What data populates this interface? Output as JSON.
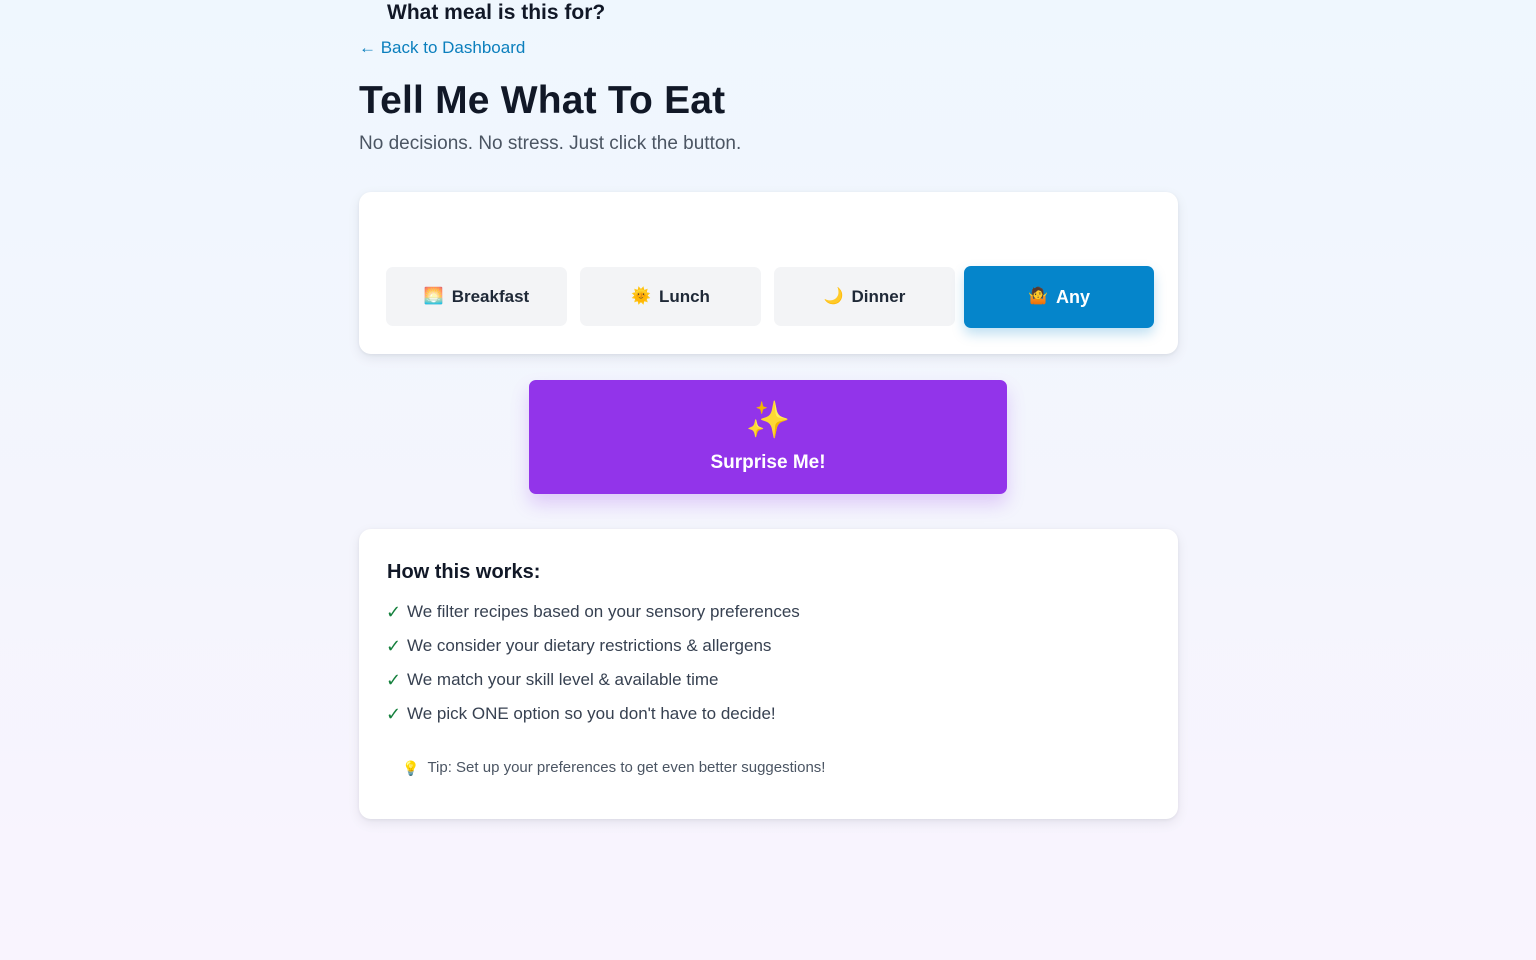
{
  "nav": {
    "back_label": "← Back to Dashboard"
  },
  "header": {
    "title": "Tell Me What To Eat",
    "subtitle": "No decisions. No stress. Just click the button."
  },
  "meal_selector": {
    "heading": "What meal is this for?",
    "options": [
      {
        "icon": "sunrise-icon",
        "emoji": "🌅",
        "label": "Breakfast",
        "selected": false
      },
      {
        "icon": "sun-icon",
        "emoji": "🌞",
        "label": "Lunch",
        "selected": false
      },
      {
        "icon": "moon-icon",
        "emoji": "🌙",
        "label": "Dinner",
        "selected": false
      },
      {
        "icon": "shrug-icon",
        "emoji": "🤷",
        "label": "Any",
        "selected": true
      }
    ]
  },
  "surprise": {
    "icon": "sparkles-icon",
    "emoji": "✨",
    "label": "Surprise Me!"
  },
  "how_it_works": {
    "heading": "How this works:",
    "check_glyph": "✓",
    "items": [
      "We filter recipes based on your sensory preferences",
      "We consider your dietary restrictions & allergens",
      "We match your skill level & available time",
      "We pick ONE option so you don't have to decide!"
    ],
    "tip_icon": "lightbulb-icon",
    "tip_emoji": "💡",
    "tip": "Tip: Set up your preferences to get even better suggestions!"
  },
  "colors": {
    "accent_blue": "#0585cb",
    "surprise_purple": "#9234ea",
    "link_blue": "#0b7fbd",
    "check_green": "#15803d"
  }
}
